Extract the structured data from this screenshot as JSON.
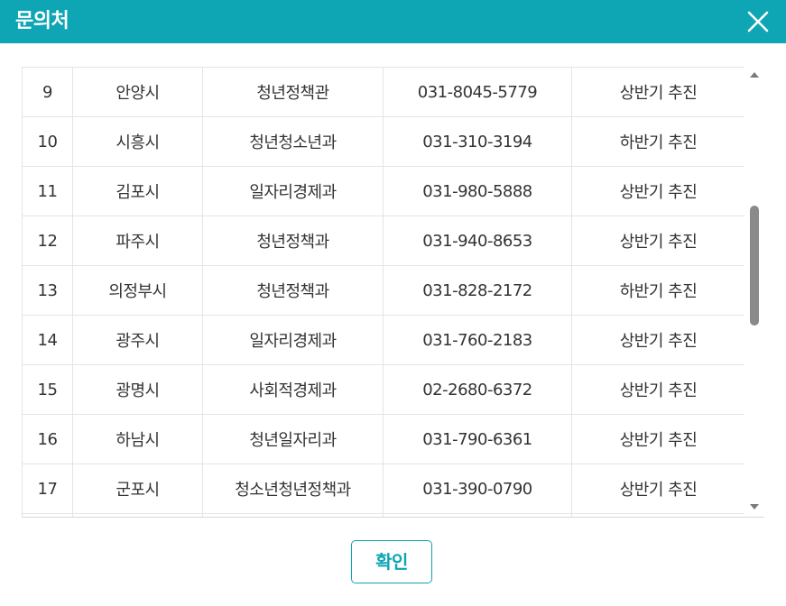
{
  "dialog": {
    "title": "문의처",
    "confirm_label": "확인",
    "accent_color": "#0ea5b4"
  },
  "table": {
    "rows": [
      {
        "no": "9",
        "city": "안양시",
        "dept": "청년정책관",
        "phone": "031-8045-5779",
        "schedule": "상반기 추진"
      },
      {
        "no": "10",
        "city": "시흥시",
        "dept": "청년청소년과",
        "phone": "031-310-3194",
        "schedule": "하반기 추진"
      },
      {
        "no": "11",
        "city": "김포시",
        "dept": "일자리경제과",
        "phone": "031-980-5888",
        "schedule": "상반기 추진"
      },
      {
        "no": "12",
        "city": "파주시",
        "dept": "청년정책과",
        "phone": "031-940-8653",
        "schedule": "상반기 추진"
      },
      {
        "no": "13",
        "city": "의정부시",
        "dept": "청년정책과",
        "phone": "031-828-2172",
        "schedule": "하반기 추진"
      },
      {
        "no": "14",
        "city": "광주시",
        "dept": "일자리경제과",
        "phone": "031-760-2183",
        "schedule": "상반기 추진"
      },
      {
        "no": "15",
        "city": "광명시",
        "dept": "사회적경제과",
        "phone": "02-2680-6372",
        "schedule": "상반기 추진"
      },
      {
        "no": "16",
        "city": "하남시",
        "dept": "청년일자리과",
        "phone": "031-790-6361",
        "schedule": "상반기 추진"
      },
      {
        "no": "17",
        "city": "군포시",
        "dept": "청소년청년정책과",
        "phone": "031-390-0790",
        "schedule": "상반기 추진"
      },
      {
        "no": "",
        "city": "",
        "dept": "",
        "phone": "",
        "schedule": ""
      }
    ]
  },
  "icons": {
    "close": "close-icon",
    "scroll_up": "scroll-up-arrow-icon",
    "scroll_down": "scroll-down-arrow-icon"
  }
}
